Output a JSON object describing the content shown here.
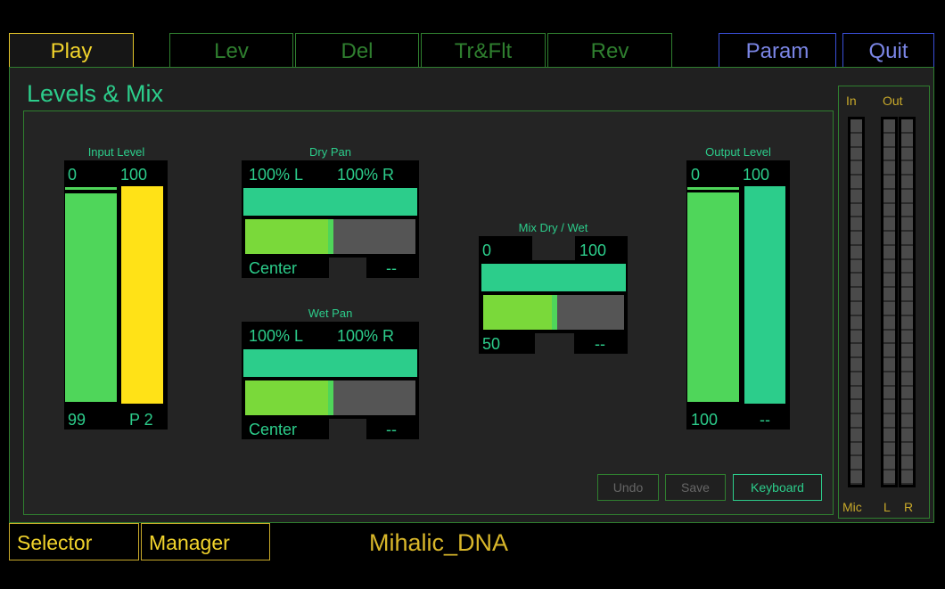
{
  "tabs": {
    "play": "Play",
    "lev": "Lev",
    "del": "Del",
    "trflt": "Tr&Flt",
    "rev": "Rev",
    "param": "Param",
    "quit": "Quit"
  },
  "page_title": "Levels & Mix",
  "input_level": {
    "title": "Input Level",
    "left_top": "0",
    "right_top": "100",
    "left_bottom": "99",
    "right_bottom": "P 2",
    "colors": {
      "left": "#4fd65a",
      "right": "#ffe217"
    }
  },
  "dry_pan": {
    "title": "Dry Pan",
    "left_label": "100% L",
    "right_label": "100% R",
    "position": "Center",
    "value": "--",
    "slider_fraction": 0.5
  },
  "wet_pan": {
    "title": "Wet Pan",
    "left_label": "100% L",
    "right_label": "100% R",
    "position": "Center",
    "value": "--",
    "slider_fraction": 0.5
  },
  "mix": {
    "title": "Mix Dry / Wet",
    "left_label": "0",
    "right_label": "100",
    "value": "50",
    "value2": "--",
    "slider_fraction": 0.5
  },
  "output_level": {
    "title": "Output Level",
    "left_top": "0",
    "right_top": "100",
    "left_bottom": "100",
    "right_bottom": "--",
    "colors": {
      "left": "#4fd65a",
      "right": "#2ccd8b"
    }
  },
  "buttons": {
    "undo": "Undo",
    "save": "Save",
    "keyboard": "Keyboard"
  },
  "meters": {
    "in_label": "In",
    "out_label": "Out",
    "mic_label": "Mic",
    "l_label": "L",
    "r_label": "R"
  },
  "footer": {
    "selector": "Selector",
    "manager": "Manager",
    "preset_name": "Mihalic_DNA"
  },
  "colors": {
    "accent_green": "#2ccd8b",
    "border_green": "#2f7f2f",
    "yellow": "#f2d42c",
    "blue": "#7b86e6"
  }
}
